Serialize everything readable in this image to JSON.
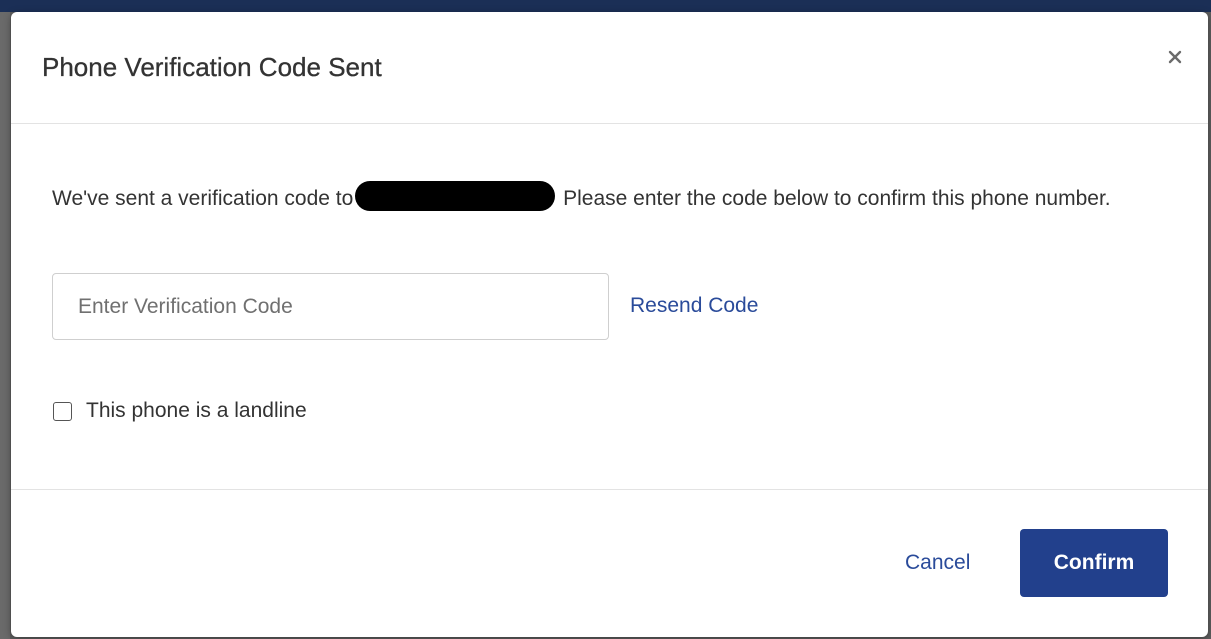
{
  "modal": {
    "title": "Phone Verification Code Sent",
    "close_label": "×"
  },
  "body": {
    "message_before": "We've sent a verification code to",
    "message_after": " Please enter the code below to confirm this phone number.",
    "code_input": {
      "value": "",
      "placeholder": "Enter Verification Code"
    },
    "resend_label": "Resend Code",
    "landline_label": "This phone is a landline",
    "landline_checked": false
  },
  "footer": {
    "cancel_label": "Cancel",
    "confirm_label": "Confirm"
  },
  "colors": {
    "primary": "#22408c",
    "link": "#2a4b9a",
    "text": "#333333"
  }
}
